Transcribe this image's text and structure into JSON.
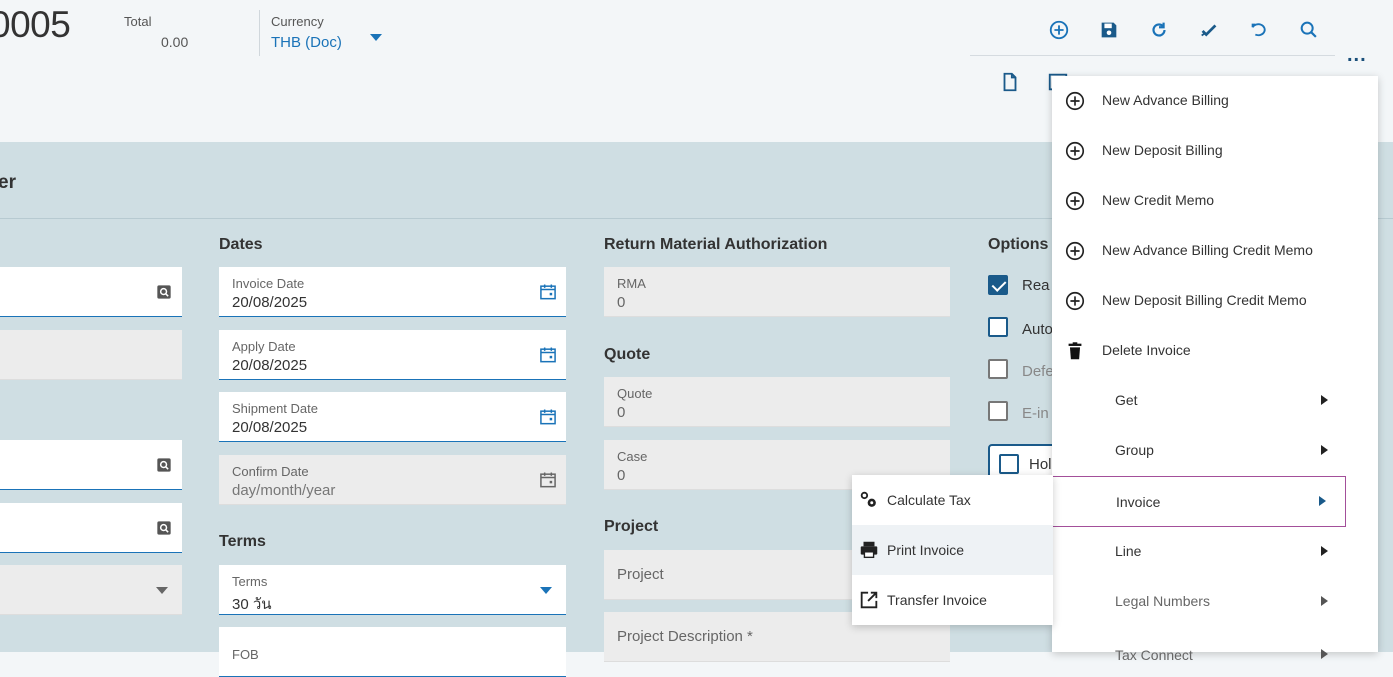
{
  "header": {
    "invoice_number": "0005",
    "total_label": "Total",
    "total_value": "0.00",
    "currency_label": "Currency",
    "currency_value": "THB (Doc)",
    "more_label": "..."
  },
  "band": {
    "title": "er"
  },
  "sections": {
    "dates": "Dates",
    "rma": "Return Material Authorization",
    "options": "Options",
    "quote": "Quote",
    "terms": "Terms",
    "project": "Project"
  },
  "fields": {
    "invoice_date": {
      "label": "Invoice Date",
      "value": "20/08/2025"
    },
    "apply_date": {
      "label": "Apply Date",
      "value": "20/08/2025"
    },
    "shipment_date": {
      "label": "Shipment Date",
      "value": "20/08/2025"
    },
    "confirm_date": {
      "label": "Confirm Date",
      "placeholder": "day/month/year"
    },
    "terms": {
      "label": "Terms",
      "value": "30 วัน"
    },
    "fob": {
      "label": "FOB"
    },
    "rma": {
      "label": "RMA",
      "value": "0"
    },
    "quote": {
      "label": "Quote",
      "value": "0"
    },
    "case": {
      "label": "Case",
      "value": "0"
    },
    "project": {
      "placeholder": "Project"
    },
    "project_description": {
      "placeholder": "Project Description *"
    }
  },
  "options": {
    "ready": "Rea",
    "auto": "Auto",
    "defer": "Defe",
    "einvoice": "E-in",
    "hold": "Hol"
  },
  "menu": {
    "items": [
      {
        "label": "New Advance Billing",
        "icon": "plus-circle-icon"
      },
      {
        "label": "New Deposit Billing",
        "icon": "plus-circle-icon"
      },
      {
        "label": "New Credit Memo",
        "icon": "plus-circle-icon"
      },
      {
        "label": "New Advance Billing Credit Memo",
        "icon": "plus-circle-icon"
      },
      {
        "label": "New Deposit Billing Credit Memo",
        "icon": "plus-circle-icon"
      },
      {
        "label": "Delete Invoice",
        "icon": "trash-icon"
      },
      {
        "label": "Get"
      },
      {
        "label": "Group"
      },
      {
        "label": "Invoice"
      },
      {
        "label": "Line"
      },
      {
        "label": "Legal Numbers"
      },
      {
        "label": "Tax Connect"
      }
    ]
  },
  "submenu": {
    "items": [
      {
        "label": "Calculate Tax",
        "icon": "gears-icon"
      },
      {
        "label": "Print Invoice",
        "icon": "printer-icon"
      },
      {
        "label": "Transfer Invoice",
        "icon": "external-link-icon"
      }
    ]
  },
  "colors": {
    "accent": "#1a73b8",
    "band": "#cfdee3",
    "active_border": "#a34f9a"
  }
}
